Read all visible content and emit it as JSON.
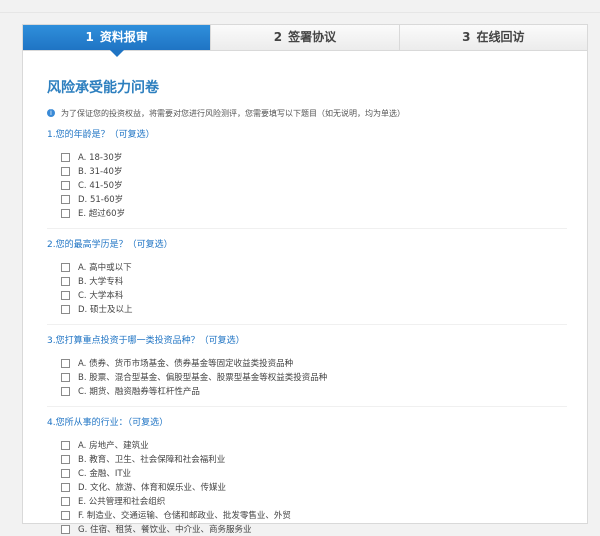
{
  "steps": [
    {
      "num": "1",
      "label": "资料报审"
    },
    {
      "num": "2",
      "label": "签署协议"
    },
    {
      "num": "3",
      "label": "在线回访"
    }
  ],
  "questionnaire": {
    "title": "风险承受能力问卷",
    "tip": "为了保证您的投资权益，将需要对您进行风险测评，您需要填写以下题目（如无说明，均为单选）",
    "questions": [
      {
        "title": "1.您的年龄是？（可复选）",
        "options": [
          "A. 18-30岁",
          "B. 31-40岁",
          "C. 41-50岁",
          "D. 51-60岁",
          "E. 超过60岁"
        ]
      },
      {
        "title": "2.您的最高学历是？（可复选）",
        "options": [
          "A. 高中或以下",
          "B. 大学专科",
          "C. 大学本科",
          "D. 硕士及以上"
        ]
      },
      {
        "title": "3.您打算重点投资于哪一类投资品种？（可复选）",
        "options": [
          "A. 债券、货币市场基金、债券基金等固定收益类投资品种",
          "B. 股票、混合型基金、偏股型基金、股票型基金等权益类投资品种",
          "C. 期货、融资融券等杠杆性产品"
        ]
      },
      {
        "title": "4.您所从事的行业：（可复选）",
        "options": [
          "A. 房地产、建筑业",
          "B. 教育、卫生、社会保障和社会福利业",
          "C. 金融、IT业",
          "D. 文化、旅游、体育和娱乐业、传媒业",
          "E. 公共管理和社会组织",
          "F. 制造业、交通运输、仓储和邮政业、批发零售业、外贸",
          "G. 住宿、租赁、餐饮业、中介业、商务服务业"
        ]
      }
    ]
  }
}
